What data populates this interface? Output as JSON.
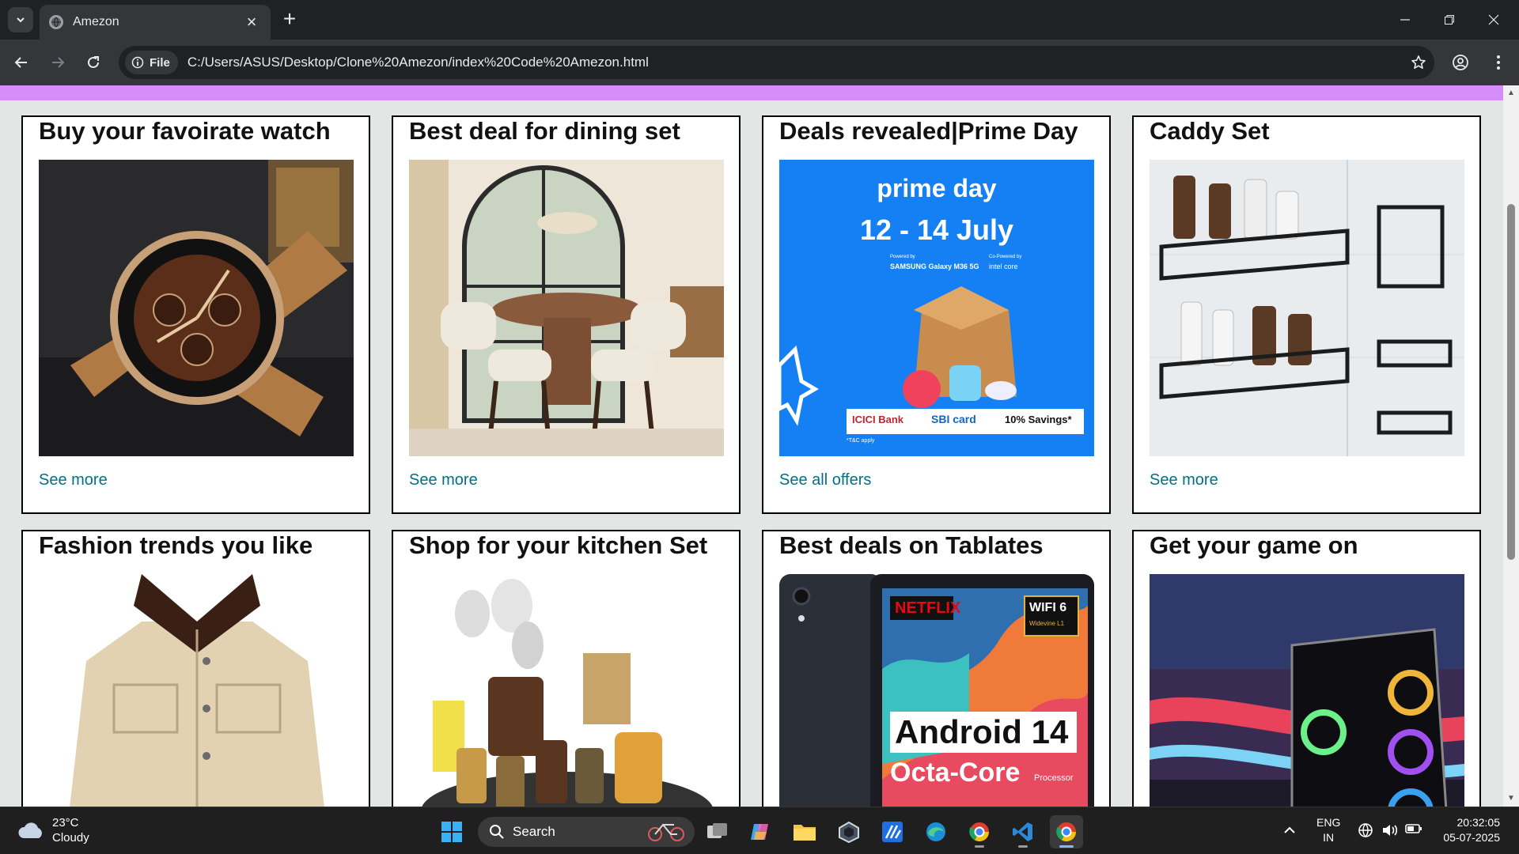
{
  "browser": {
    "tab_title": "Amezon",
    "address_chip": "File",
    "url": "C:/Users/ASUS/Desktop/Clone%20Amezon/index%20Code%20Amezon.html",
    "icons": [
      "tab-search-icon",
      "globe-favicon-icon",
      "close-icon",
      "plus-icon",
      "minimize-icon",
      "restore-icon",
      "close-window-icon",
      "back-icon",
      "forward-icon",
      "reload-icon",
      "info-icon",
      "star-icon",
      "profile-icon",
      "menu-icon"
    ]
  },
  "page": {
    "accent_strip_color": "#d78cfb",
    "link_color": "#007185",
    "cards_row1": [
      {
        "title": "Buy your favoirate watch",
        "link": "See more",
        "image": "watch"
      },
      {
        "title": "Best deal for dining set",
        "link": "See more",
        "image": "dining-set"
      },
      {
        "title": "Deals revealed|Prime Day",
        "link": "See all offers",
        "image": "prime-day-banner"
      },
      {
        "title": "Caddy Set",
        "link": "See more",
        "image": "shower-caddy"
      }
    ],
    "cards_row2": [
      {
        "title": "Fashion trends you like",
        "image": "jacket"
      },
      {
        "title": "Shop for your kitchen Set",
        "image": "kitchen-organizer"
      },
      {
        "title": "Best deals on Tablates",
        "image": "tablet"
      },
      {
        "title": "Get your game on",
        "image": "gaming-pc"
      }
    ],
    "prime_banner": {
      "brand": "prime day",
      "dates": "12 - 14 July",
      "powered": "Powered by",
      "sponsor1": "SAMSUNG Galaxy M36 5G",
      "copowered": "Co-Powered by",
      "sponsor2": "intel core",
      "bank1": "ICICI Bank",
      "bank2": "SBI card",
      "savings": "10% Savings*",
      "tnc": "*T&C apply"
    },
    "tablet_banner": {
      "brand": "NETFLIX",
      "wifi": "WIFI 6",
      "widevine": "Widevine L1",
      "os": "Android 14",
      "cpu": "Octa-Core",
      "cpu_suffix": "Processor"
    }
  },
  "taskbar": {
    "temperature": "23°C",
    "condition": "Cloudy",
    "search_label": "Search",
    "language": "ENG",
    "region": "IN",
    "time": "20:32:05",
    "date": "05-07-2025"
  }
}
